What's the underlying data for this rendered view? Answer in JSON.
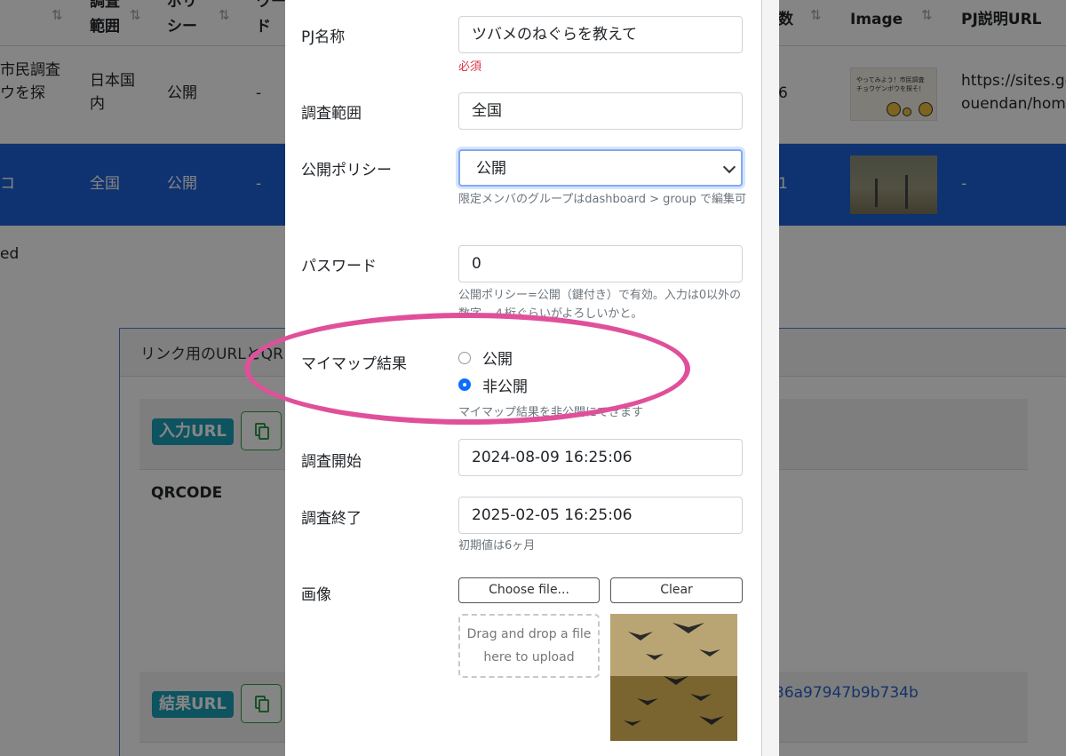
{
  "table": {
    "headers": {
      "col_range": "調査\n範囲",
      "col_policy": "ポリ\nシー",
      "col_pw": "ワー\nド",
      "col_count": "数",
      "col_image": "Image",
      "col_url": "PJ説明URL"
    },
    "rows": [
      {
        "name": "市民調査\nウを探",
        "range": "日本国\n内",
        "policy": "公開",
        "pw": "-",
        "count": "6",
        "thumb_text": "やってみよう！市民調査\nチョウゲンボウを探そ！",
        "url": "https://sites.go\nouendan/home"
      },
      {
        "name": "コ",
        "range": "全国",
        "policy": "公開",
        "pw": "-",
        "count": "1",
        "url": "-"
      }
    ],
    "below_text": "ed"
  },
  "link_panel": {
    "header": "リンク用のURLとQR",
    "input_badge": "入力URL",
    "result_badge": "結果URL",
    "qrcode_label": "QRCODE",
    "result_hash": "36a97947b9b734b"
  },
  "modal": {
    "name_label": "PJ名称",
    "name_value": "ツバメのねぐらを教えて",
    "name_required": "必須",
    "range_label": "調査範囲",
    "range_value": "全国",
    "policy_label": "公開ポリシー",
    "policy_value": "公開",
    "policy_help": "限定メンバのグループはdashboard > group で編集可",
    "password_label": "パスワード",
    "password_value": "0",
    "password_help": "公開ポリシー=公開（鍵付き）で有効。入力は0以外の数字、４桁ぐらいがよろしいかと。",
    "mymap_label": "マイマップ結果",
    "mymap_options": [
      "公開",
      "非公開"
    ],
    "mymap_selected": "非公開",
    "mymap_help": "マイマップ結果を非公開にできます",
    "start_label": "調査開始",
    "start_value": "2024-08-09 16:25:06",
    "end_label": "調査終了",
    "end_value": "2025-02-05 16:25:06",
    "end_help": "初期値は6ヶ月",
    "image_label": "画像",
    "choose_file": "Choose file...",
    "clear": "Clear",
    "dropzone_text": "Drag and drop a file here to upload"
  },
  "colors": {
    "highlight_row": "#1e63d6",
    "annotation_ellipse": "#e0509a",
    "badge": "#1aa0b8",
    "required": "#dc3545"
  }
}
